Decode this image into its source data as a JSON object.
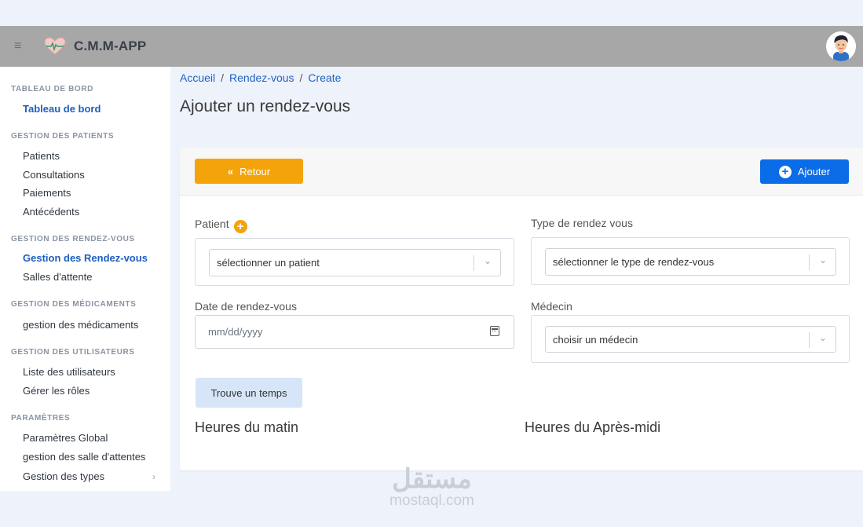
{
  "app": {
    "brand": "C.M.M-APP"
  },
  "breadcrumb": {
    "home": "Accueil",
    "section": "Rendez-vous",
    "current": "Create",
    "separator": "/"
  },
  "page": {
    "title": "Ajouter un rendez-vous"
  },
  "sidebar": {
    "sections": [
      {
        "title": "TABLEAU DE BORD",
        "items": [
          "Tableau de bord"
        ]
      },
      {
        "title": "GESTION DES PATIENTS",
        "items": [
          "Patients",
          "Consultations",
          "Paiements",
          "Antécédents"
        ]
      },
      {
        "title": "GESTION DES RENDEZ-VOUS",
        "items": [
          "Gestion des Rendez-vous",
          "Salles d'attente"
        ]
      },
      {
        "title": "GESTION DES MÉDICAMENTS",
        "items": [
          "gestion des médicaments"
        ]
      },
      {
        "title": "GESTION DES UTILISATEURS",
        "items": [
          "Liste des utilisateurs",
          "Gérer les rôles"
        ]
      },
      {
        "title": "PARAMÈTRES",
        "items": [
          "Paramètres Global",
          "gestion des salle d'attentes",
          "Gestion des types"
        ]
      }
    ],
    "active_items": [
      "Tableau de bord",
      "Gestion des Rendez-vous"
    ]
  },
  "actions": {
    "back_label": "Retour",
    "add_label": "Ajouter"
  },
  "form": {
    "patient_label": "Patient",
    "patient_placeholder": "sélectionner un patient",
    "type_label": "Type de rendez vous",
    "type_placeholder": "sélectionner le type de rendez-vous",
    "date_label": "Date de rendez-vous",
    "date_placeholder": "mm/dd/yyyy",
    "doctor_label": "Médecin",
    "doctor_placeholder": "choisir un médecin",
    "find_time_label": "Trouve un temps"
  },
  "schedule": {
    "morning_title": "Heures du matin",
    "afternoon_title": "Heures du Après-midi"
  },
  "watermark": {
    "arabic": "مستقل",
    "latin": "mostaql.com"
  },
  "colors": {
    "primary": "#0b6ce8",
    "warning": "#f5a30b",
    "navbar": "#a7a7a7",
    "active_link": "#1d5fbf"
  }
}
